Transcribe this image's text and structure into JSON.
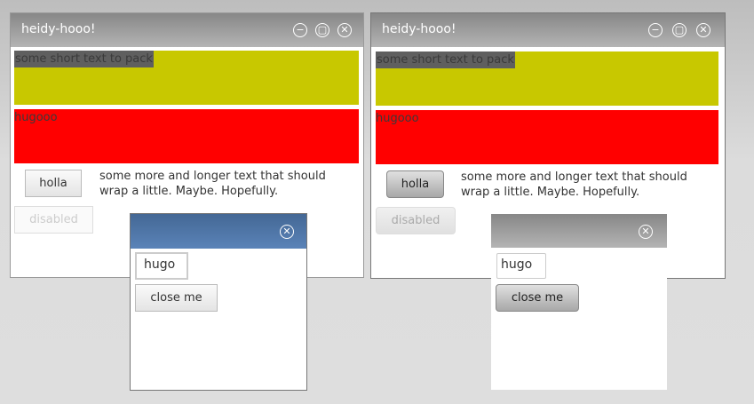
{
  "windows": [
    {
      "title": "heidy-hooo!",
      "packed_label": "some short text to pack",
      "red_label": "hugooo",
      "button": "holla",
      "wrap_text": "some more and longer text that should wrap a little. Maybe. Hopefully.",
      "disabled_button": "disabled"
    },
    {
      "title": "heidy-hooo!",
      "packed_label": "some short text to pack",
      "red_label": "hugooo",
      "button": "holla",
      "wrap_text": "some more and longer text that should wrap a little. Maybe. Hopefully.",
      "disabled_button": "disabled"
    }
  ],
  "dialogs": [
    {
      "input_value": "hugo",
      "close_button": "close me"
    },
    {
      "input_value": "hugo",
      "close_button": "close me"
    }
  ],
  "icons": {
    "minimize": "−",
    "maximize": "▢",
    "close": "✕"
  },
  "colors": {
    "yellow": "#c8c800",
    "red": "#ff0000",
    "dialog_header_blue": "#4f77aa"
  }
}
